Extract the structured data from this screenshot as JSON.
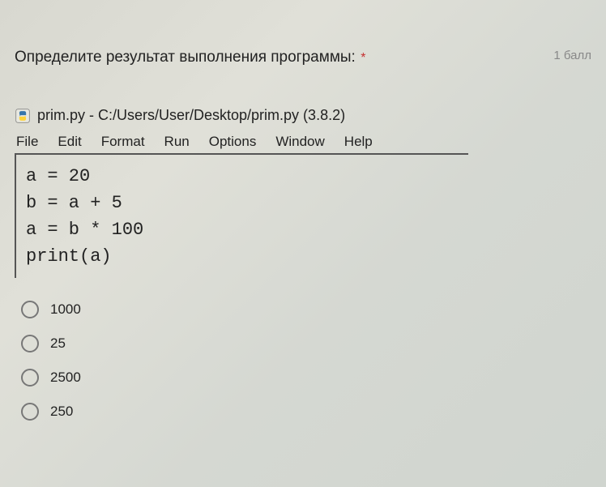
{
  "question": {
    "title": "Определите результат выполнения программы:",
    "required_mark": "*",
    "points": "1 балл"
  },
  "editor": {
    "title": "prim.py - C:/Users/User/Desktop/prim.py (3.8.2)",
    "menu": {
      "file": "File",
      "edit": "Edit",
      "format": "Format",
      "run": "Run",
      "options": "Options",
      "window": "Window",
      "help": "Help"
    },
    "code": "a = 20\nb = a + 5\na = b * 100\nprint(a)"
  },
  "answers": {
    "opt1": "1000",
    "opt2": "25",
    "opt3": "2500",
    "opt4": "250"
  }
}
